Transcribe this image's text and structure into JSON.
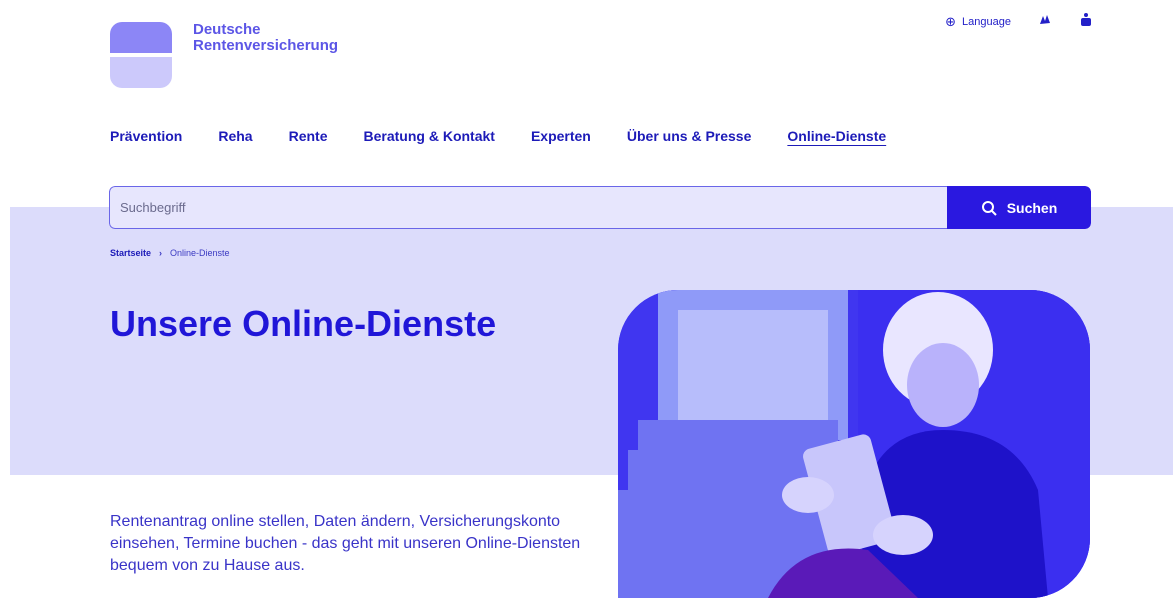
{
  "brand": {
    "line1": "Deutsche",
    "line2": "Rentenversicherung"
  },
  "utilities": {
    "language_label": "Language"
  },
  "nav": [
    {
      "label": "Prävention"
    },
    {
      "label": "Reha"
    },
    {
      "label": "Rente"
    },
    {
      "label": "Beratung & Kontakt"
    },
    {
      "label": "Experten"
    },
    {
      "label": "Über uns & Presse"
    },
    {
      "label": "Online-Dienste",
      "active": true
    }
  ],
  "search": {
    "placeholder": "Suchbegriff",
    "button_label": "Suchen"
  },
  "breadcrumb": {
    "home": "Startseite",
    "separator": "›",
    "current": "Online-Dienste"
  },
  "page": {
    "title": "Unsere Online-Dienste",
    "intro": "Rentenantrag online stellen, Daten ändern, Versicherungskonto einsehen, Termine buchen - das geht mit unseren Online-Diensten bequem von zu Hause aus."
  },
  "colors": {
    "accent": "#2a18e0",
    "band": "#dcdcfb",
    "text": "#2016d8"
  }
}
